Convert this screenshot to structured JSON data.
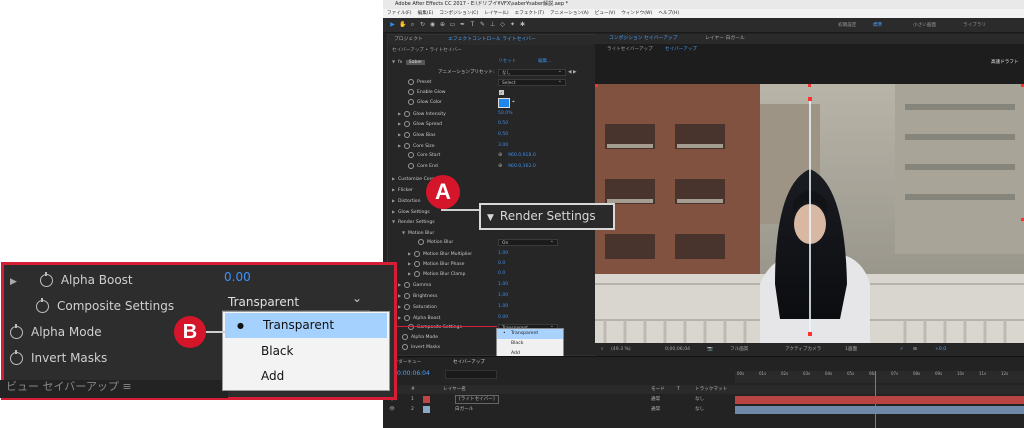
{
  "window": {
    "title": "Adobe After Effects CC 2017 - E:\\ドリブイ¥VFX\\saber¥saber解説.aep *"
  },
  "menu": [
    "ファイル(F)",
    "編集(E)",
    "コンポジション(C)",
    "レイヤー(L)",
    "エフェクト(T)",
    "アニメーション(A)",
    "ビュー(V)",
    "ウィンドウ(W)",
    "ヘルプ(H)"
  ],
  "workspaces": [
    "初期設定",
    "標準",
    "小さい画面",
    "ライブラリ"
  ],
  "effect_controls": {
    "tabs": [
      "プロジェクト",
      "エフェクトコントロール ライトセイバー"
    ],
    "breadcrumb": "セイバーアップ • ライトセイバー",
    "effect_name": "Saber",
    "reset_label": "リセット",
    "edit_label": "編集...",
    "anim_preset_label": "アニメーションプリセット:",
    "anim_preset_value": "なし",
    "preset_label": "Preset",
    "preset_value": "Select",
    "rows": [
      {
        "label": "Enable Glow"
      },
      {
        "label": "Glow Color"
      },
      {
        "label": "Glow Intensity",
        "value": "50.0%"
      },
      {
        "label": "Glow Spread",
        "value": "0.50"
      },
      {
        "label": "Glow Bias",
        "value": "0.50"
      },
      {
        "label": "Core Size",
        "value": "3.00"
      },
      {
        "label": "Core Start",
        "value": "960.0,918.0"
      },
      {
        "label": "Core End",
        "value": "960.0,162.0"
      },
      {
        "label": "Customize Core"
      },
      {
        "label": "Flicker"
      },
      {
        "label": "Distortion"
      },
      {
        "label": "Glow Settings"
      },
      {
        "label": "Render Settings"
      },
      {
        "label": "Motion Blur"
      },
      {
        "label": "Motion Blur",
        "value": "On"
      },
      {
        "label": "Motion Blur Multiplier",
        "value": "1.00"
      },
      {
        "label": "Motion Blur Phase",
        "value": "0.0"
      },
      {
        "label": "Motion Blur Clamp",
        "value": "0.0"
      },
      {
        "label": "Gamma",
        "value": "1.00"
      },
      {
        "label": "Brightness",
        "value": "1.00"
      },
      {
        "label": "Saturation",
        "value": "1.00"
      },
      {
        "label": "Alpha Boost",
        "value": "0.00"
      },
      {
        "label": "Composite Settings",
        "value": "Transparent"
      },
      {
        "label": "Alpha Mode"
      },
      {
        "label": "Invert Masks"
      }
    ],
    "composite_options": [
      "Transparent",
      "Black",
      "Add"
    ]
  },
  "viewer": {
    "tabs": [
      "コンポジション セイバーアップ",
      "レイヤー 白ガール"
    ],
    "breadcrumb": [
      "ライトセイバーアップ",
      "セイバーアップ"
    ],
    "label": "高速ドラフト",
    "zoom": "(49.3 %)",
    "timecode": "0;00;06;04",
    "quality": "フル画質",
    "camera": "アクティブカメラ",
    "views": "1画面",
    "exposure": "+0.0"
  },
  "timeline": {
    "tabs": [
      "レンダーキュー",
      "セイバーアップ"
    ],
    "timecode": "0:00:06:04",
    "header": [
      "#",
      "レイヤー名",
      "モード",
      "T",
      "トラックマット"
    ],
    "layers": [
      {
        "num": "1",
        "name": "[ライトセイバー]",
        "mode": "通常",
        "matte": "なし"
      },
      {
        "num": "2",
        "name": "白ガール",
        "mode": "通常",
        "matte": "なし"
      }
    ],
    "ruler": [
      "00s",
      "01s",
      "02s",
      "03s",
      "04s",
      "05s",
      "06s",
      "07s",
      "08s",
      "09s",
      "10s",
      "11s",
      "12s"
    ]
  },
  "callout_a": {
    "badge": "A",
    "text": "Render Settings"
  },
  "callout_b": {
    "badge": "B",
    "rows": [
      {
        "label": "Alpha Boost",
        "value": "0.00"
      },
      {
        "label": "Composite Settings",
        "value": "Transparent"
      },
      {
        "label": "Alpha Mode"
      },
      {
        "label": "Invert Masks"
      }
    ],
    "options": [
      "Transparent",
      "Black",
      "Add"
    ],
    "bottom_text": "ビュー  セイバーアップ ≡"
  },
  "colors": {
    "accent": "#2d8ceb",
    "badge": "#d5152a",
    "saber": "#5fb4ff"
  }
}
